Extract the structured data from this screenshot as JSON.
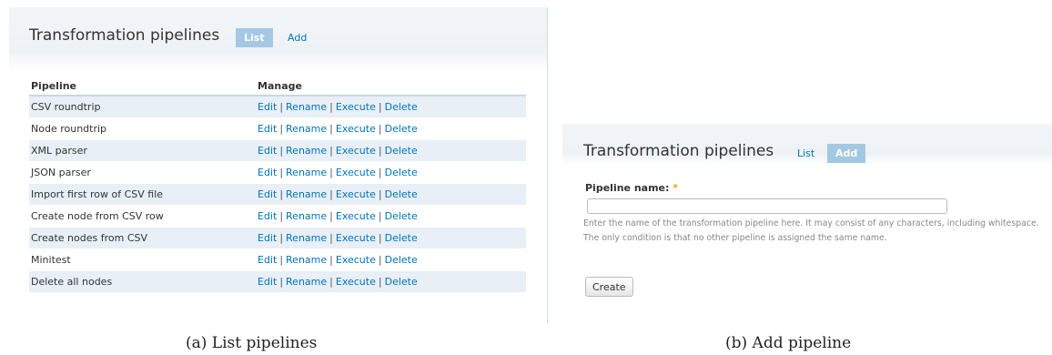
{
  "list_panel": {
    "title": "Transformation pipelines",
    "tabs": {
      "list": "List",
      "add": "Add"
    },
    "columns": {
      "pipeline": "Pipeline",
      "manage": "Manage"
    },
    "actions": {
      "edit": "Edit",
      "rename": "Rename",
      "execute": "Execute",
      "delete": "Delete",
      "separator": "|"
    },
    "rows": [
      "CSV roundtrip",
      "Node roundtrip",
      "XML parser",
      "JSON parser",
      "Import first row of CSV file",
      "Create node from CSV row",
      "Create nodes from CSV",
      "Minitest",
      "Delete all nodes"
    ]
  },
  "add_panel": {
    "title": "Transformation pipelines",
    "tabs": {
      "list": "List",
      "add": "Add"
    },
    "field_label": "Pipeline name:",
    "required_marker": "*",
    "field_value": "",
    "help_text": "Enter the name of the transformation pipeline here. It may consist of any characters, including whitespace. The only condition is that no other pipeline is assigned the same name.",
    "create_label": "Create"
  },
  "captions": {
    "a": "(a) List pipelines",
    "b": "(b) Add pipeline"
  },
  "colors": {
    "link": "#0074bd",
    "active_tab": "#a4c8e3",
    "row_stripe": "#e8eff6",
    "required": "#f39c12"
  }
}
